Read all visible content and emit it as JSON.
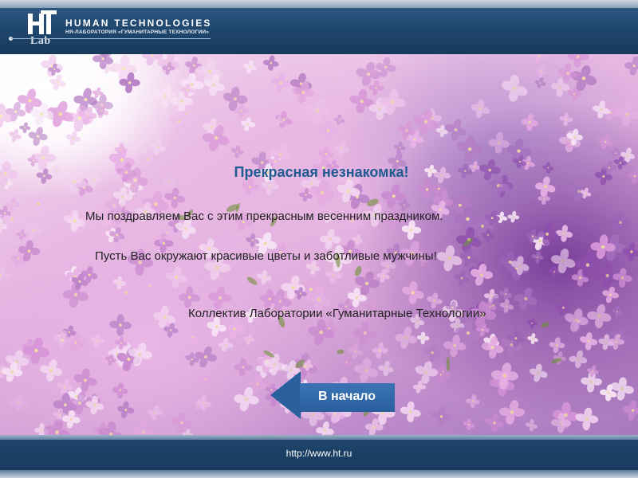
{
  "header": {
    "logo_letters": "HT",
    "logo_lab": "Lab",
    "title": "HUMAN TECHNOLOGIES",
    "subtitle": "НЯ-ЛАБОРАТОРИЯ «ГУМАНИТАРНЫЕ ТЕХНОЛОГИИ»",
    "color": "#1f466d"
  },
  "main": {
    "title": "Прекрасная незнакомка!",
    "line1": "Мы поздравляем Вас с этим прекрасным весенним праздником.",
    "line2": "Пусть Вас окружают красивые цветы и заботливые мужчины!",
    "signature": "Коллектив Лаборатории «Гуманитарные Технологии»",
    "title_color": "#1f5a90",
    "background": "lilac-flowers-photo"
  },
  "nav": {
    "back_label": "В начало",
    "back_icon": "arrow-left-icon",
    "button_color": "#2a5f9e"
  },
  "footer": {
    "url": "http://www.ht.ru"
  }
}
